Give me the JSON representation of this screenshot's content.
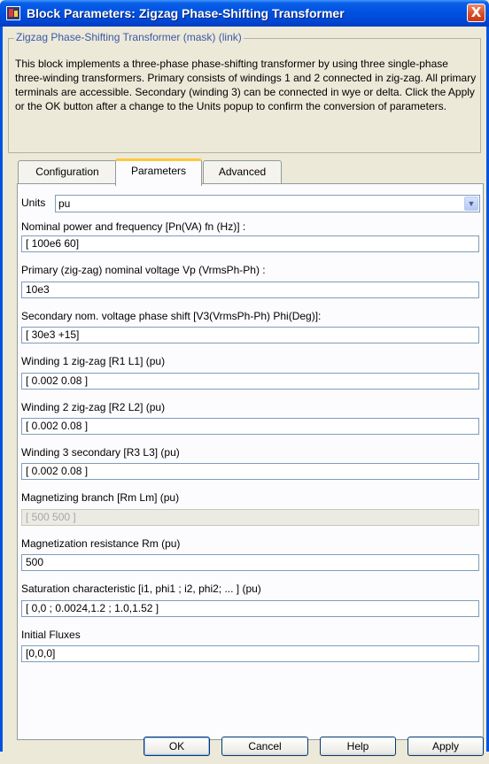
{
  "window": {
    "title": "Block Parameters: Zigzag Phase-Shifting Transformer",
    "close_label": "X"
  },
  "description": {
    "legend": "Zigzag Phase-Shifting Transformer (mask) (link)",
    "text": "This block implements a three-phase phase-shifting transformer by using three single-phase three-winding transformers. Primary consists of windings 1 and 2 connected in zig-zag. All primary terminals are accessible. Secondary (winding 3) can be connected in wye or delta. Click the Apply or the OK button after a change to the Units popup to confirm the conversion of parameters."
  },
  "tabs": [
    {
      "label": "Configuration",
      "active": false
    },
    {
      "label": "Parameters",
      "active": true
    },
    {
      "label": "Advanced",
      "active": false
    }
  ],
  "units": {
    "label": "Units",
    "value": "pu"
  },
  "params": [
    {
      "label": "Nominal power and frequency [Pn(VA) fn (Hz)] :",
      "value": "[ 100e6 60]",
      "enabled": true
    },
    {
      "label": "Primary (zig-zag) nominal voltage Vp (VrmsPh-Ph) :",
      "value": "10e3",
      "enabled": true
    },
    {
      "label": "Secondary nom. voltage  phase shift [V3(VrmsPh-Ph) Phi(Deg)]:",
      "value": "[ 30e3  +15]",
      "enabled": true
    },
    {
      "label": "Winding 1 zig-zag [R1 L1] (pu)",
      "value": "[ 0.002 0.08 ]",
      "enabled": true
    },
    {
      "label": "Winding 2 zig-zag [R2 L2] (pu)",
      "value": "[ 0.002  0.08 ]",
      "enabled": true
    },
    {
      "label": "Winding 3 secondary [R3 L3] (pu)",
      "value": "[ 0.002 0.08 ]",
      "enabled": true
    },
    {
      "label": "Magnetizing branch [Rm Lm] (pu)",
      "value": "[ 500 500 ]",
      "enabled": false
    },
    {
      "label": "Magnetization resistance Rm (pu)",
      "value": "500",
      "enabled": true
    },
    {
      "label": "Saturation characteristic [i1, phi1 ; i2, phi2; ... ] (pu)",
      "value": "[ 0,0 ; 0.0024,1.2 ; 1.0,1.52 ]",
      "enabled": true
    },
    {
      "label": "Initial Fluxes",
      "value": "[0,0,0]",
      "enabled": true
    }
  ],
  "buttons": {
    "ok": "OK",
    "cancel": "Cancel",
    "help": "Help",
    "apply": "Apply"
  }
}
